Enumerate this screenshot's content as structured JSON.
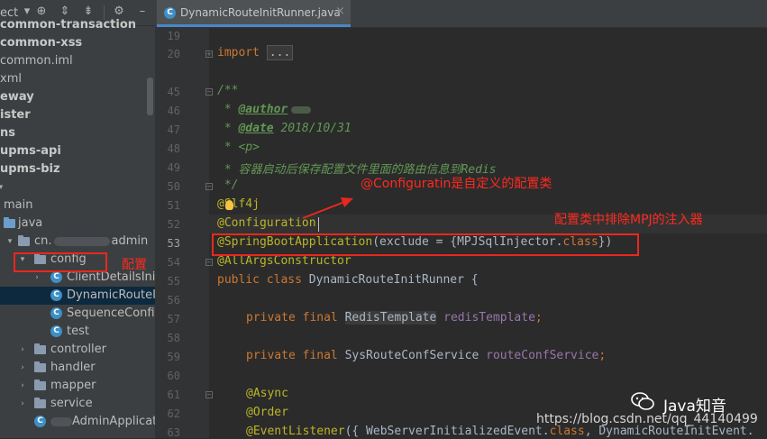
{
  "project_panel": {
    "header_text": "ect",
    "tree": [
      {
        "label": "common-transaction",
        "bold": true
      },
      {
        "label": "common-xss",
        "bold": true
      },
      {
        "label": "common.iml",
        "bold": false
      },
      {
        "label": "xml",
        "bold": false
      },
      {
        "label": "eway",
        "bold": true
      },
      {
        "label": "ister",
        "bold": true
      },
      {
        "label": "ns",
        "bold": true
      },
      {
        "label": "upms-api",
        "bold": true
      },
      {
        "label": "upms-biz",
        "bold": true
      },
      {
        "label": "main",
        "bold": false
      },
      {
        "label": "java",
        "bold": false
      },
      {
        "label_prefix": "cn.",
        "label_suffix": "admin",
        "bold": false
      },
      {
        "label": "config",
        "bold": false
      },
      {
        "label": "ClientDetailsInitR",
        "bold": false
      },
      {
        "label": "DynamicRouteIni",
        "bold": false
      },
      {
        "label": "SequenceConfig",
        "bold": false
      },
      {
        "label": "test",
        "bold": false
      },
      {
        "label": "controller",
        "bold": false
      },
      {
        "label": "handler",
        "bold": false
      },
      {
        "label": "mapper",
        "bold": false
      },
      {
        "label": "service",
        "bold": false
      },
      {
        "label": "AdminApplicatio",
        "bold": false
      }
    ]
  },
  "editor": {
    "tab_label": "DynamicRouteInitRunner.java",
    "tab_close": "×",
    "line_numbers": [
      "19",
      "20",
      "45",
      "46",
      "47",
      "48",
      "49",
      "50",
      "51",
      "52",
      "53",
      "54",
      "55",
      "56",
      "57",
      "58",
      "59",
      "60",
      "61",
      "62",
      "63",
      "64",
      "65"
    ],
    "active_line": "53",
    "code": {
      "import_kw": "import",
      "import_dots": "...",
      "doc_open": "/**",
      "doc_star": " * ",
      "author_tag": "@author",
      "date_tag": "@date",
      "date_value": " 2018/10/31",
      "p_tag": "<p>",
      "doc_desc": "容器启动后保存配置文件里面的路由信息到Redis",
      "doc_close": " */",
      "slf4j": "@Slf4j",
      "configuration": "@Configuration",
      "sba_ann": "@SpringBootApplication",
      "sba_args": "(exclude = {MPJSqlInjector.",
      "sba_class": "class",
      "sba_close": "})",
      "allargs": "@AllArgsConstructor",
      "public_kw": "public class",
      "class_name": " DynamicRouteInitRunner {",
      "private_final": "private final",
      "redis_type": "RedisTemplate",
      "redis_field": "redisTemplate",
      "semicolon": ";",
      "sysroute_type": " SysRouteConfService ",
      "sysroute_field": "routeConfService",
      "async": "@Async",
      "order": "@Order",
      "event_ann": "@EventListener",
      "event_args": "({ WebServerInitializedEvent.",
      "event_class": "class",
      "event_tail": ", DynamicRouteInitEvent."
    }
  },
  "annotations": {
    "config_label": "配置",
    "configuration_note": "@Configuratin是自定义的配置类",
    "exclude_note": "配置类中排除MPJ的注入器"
  },
  "watermark": {
    "name": "Java知音",
    "url": "https://blog.csdn.net/qq_44140499"
  },
  "colors": {
    "annotation_red": "#e8281e",
    "keyword": "#cc7832",
    "annotation_yellow": "#bbb529"
  }
}
